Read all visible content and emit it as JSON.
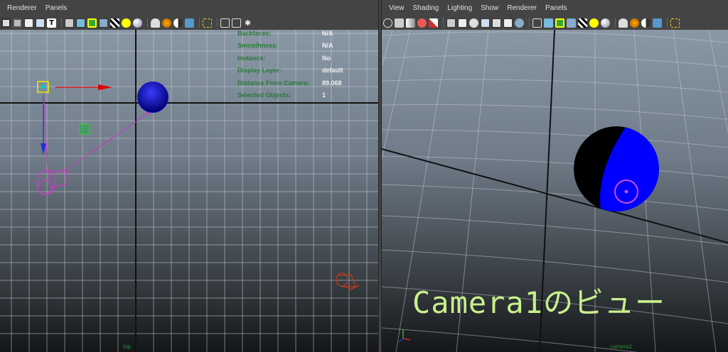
{
  "left": {
    "menu": [
      "Renderer",
      "Panels"
    ],
    "hud": [
      {
        "label": "Backfaces:",
        "value": "N/A"
      },
      {
        "label": "Smoothness:",
        "value": "N/A"
      },
      {
        "label": "Instance:",
        "value": "No"
      },
      {
        "label": "Display Layer:",
        "value": "default"
      },
      {
        "label": "Distance From Camera:",
        "value": "89.068"
      },
      {
        "label": "Selected Objects:",
        "value": "1"
      }
    ],
    "camera_label": "top"
  },
  "right": {
    "menu": [
      "View",
      "Shading",
      "Lighting",
      "Show",
      "Renderer",
      "Panels"
    ],
    "camera_label": "camera1",
    "caption": "Camera1のビュー"
  },
  "colors": {
    "menubar": "#444444",
    "sphere": "#0000ff",
    "sphere_dark": "#1a1a8a",
    "selection_magenta": "#c040c0",
    "caption_green": "#c8f08a",
    "hud_green": "#2a7a3a"
  }
}
